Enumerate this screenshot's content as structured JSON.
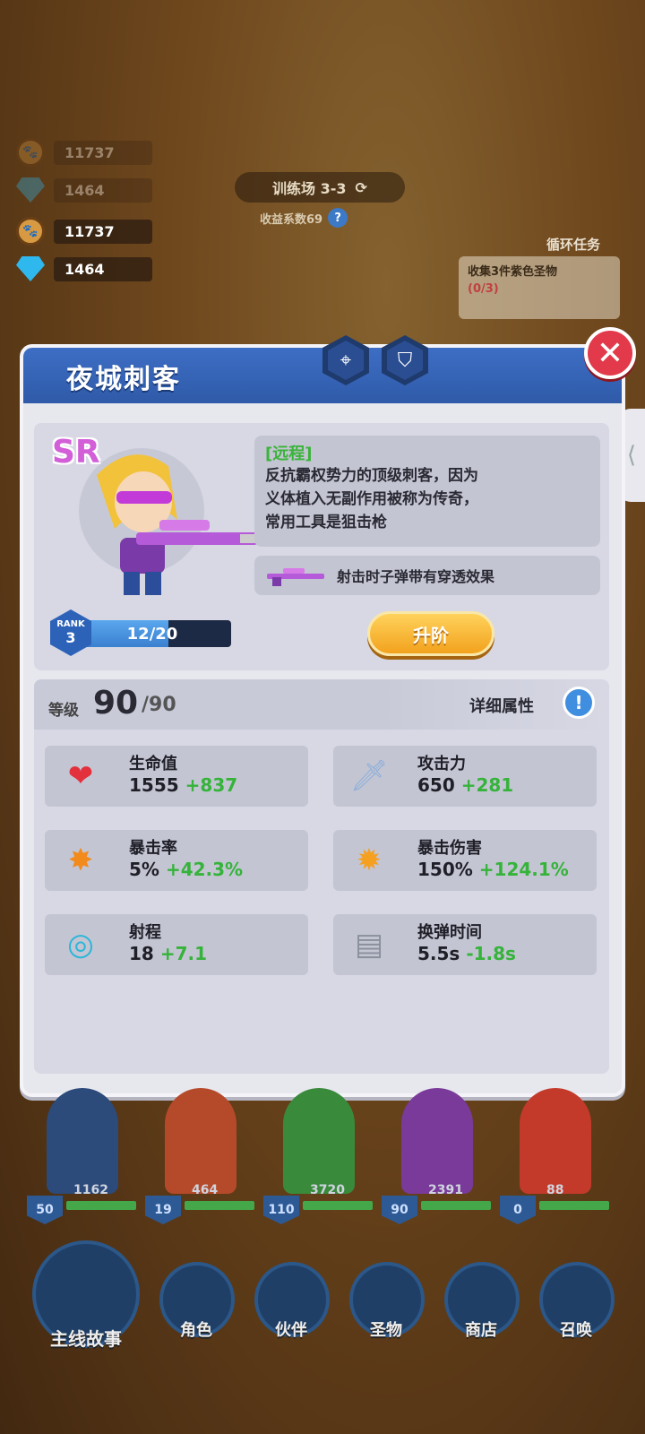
{
  "currency": {
    "paws": "11737",
    "gems": "1464"
  },
  "stage": {
    "name": "训练场 3-3",
    "coef": "收益系数69"
  },
  "quest": {
    "title": "循环任务",
    "desc": "收集3件紫色圣物",
    "progress": "(0/3)"
  },
  "hero": {
    "name": "夜城刺客",
    "rarity": "SR",
    "tag": "[远程]",
    "description_lines": [
      "反抗霸权势力的顶级刺客，因为",
      "义体植入无副作用被称为传奇，",
      "常用工具是狙击枪"
    ],
    "skill": "射击时子弹带有穿透效果",
    "rank_label": "RANK",
    "rank": "3",
    "rank_progress": "12/20",
    "rank_fraction": 0.6,
    "upgrade_label": "升阶"
  },
  "level": {
    "label": "等级",
    "value": "90",
    "max": "/90",
    "detail_label": "详细属性"
  },
  "stats": [
    {
      "name": "生命值",
      "base": "1555",
      "bonus": "+837",
      "icon": "heart-icon"
    },
    {
      "name": "攻击力",
      "base": "650",
      "bonus": "+281",
      "icon": "dagger-icon"
    },
    {
      "name": "暴击率",
      "base": "5%",
      "bonus": "+42.3%",
      "icon": "explosion-icon"
    },
    {
      "name": "暴击伤害",
      "base": "150%",
      "bonus": "+124.1%",
      "icon": "burst-icon"
    },
    {
      "name": "射程",
      "base": "18",
      "bonus": "+7.1",
      "icon": "range-icon"
    },
    {
      "name": "换弹时间",
      "base": "5.5s",
      "bonus": "-1.8s",
      "icon": "magazine-icon"
    }
  ],
  "team": [
    {
      "level": "50",
      "hp": "1162",
      "color": "#2c4a7a"
    },
    {
      "level": "19",
      "hp": "464",
      "color": "#b54a2a"
    },
    {
      "level": "110",
      "hp": "3720",
      "color": "#3a8a3c"
    },
    {
      "level": "90",
      "hp": "2391",
      "color": "#7a3a9a"
    },
    {
      "level": "0",
      "hp": "88",
      "color": "#c43a2a"
    }
  ],
  "nav": [
    "主线故事",
    "角色",
    "伙伴",
    "圣物",
    "商店",
    "召唤"
  ],
  "colors": {
    "accent": "#3d6ec5",
    "bonus": "#35b33a",
    "close": "#e23a4a",
    "upgrade": "#f2a21d"
  }
}
